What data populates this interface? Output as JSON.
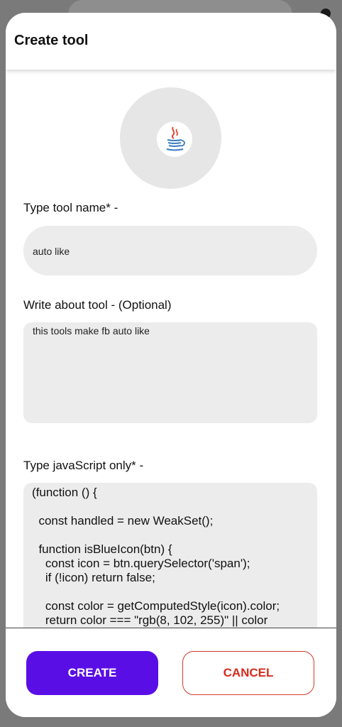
{
  "dialog": {
    "title": "Create tool"
  },
  "avatar": {
    "icon": "java-coffee-cup-icon"
  },
  "tool_name": {
    "label": "Type tool name* -",
    "value": "auto like"
  },
  "about": {
    "label": "Write about tool - (Optional)",
    "value": "this tools make fb auto like"
  },
  "script": {
    "label": "Type javaScript only* -",
    "value": "(function () {\n\n  const handled = new WeakSet();\n\n  function isBlueIcon(btn) {\n    const icon = btn.querySelector('span');\n    if (!icon) return false;\n\n    const color = getComputedStyle(icon).color;\n    return color === \"rgb(8, 102, 255)\" || color"
  },
  "actions": {
    "create_label": "CREATE",
    "cancel_label": "CANCEL"
  },
  "colors": {
    "primary": "#5a0ee6",
    "danger": "#d62b1e",
    "field_bg": "#ececec"
  }
}
